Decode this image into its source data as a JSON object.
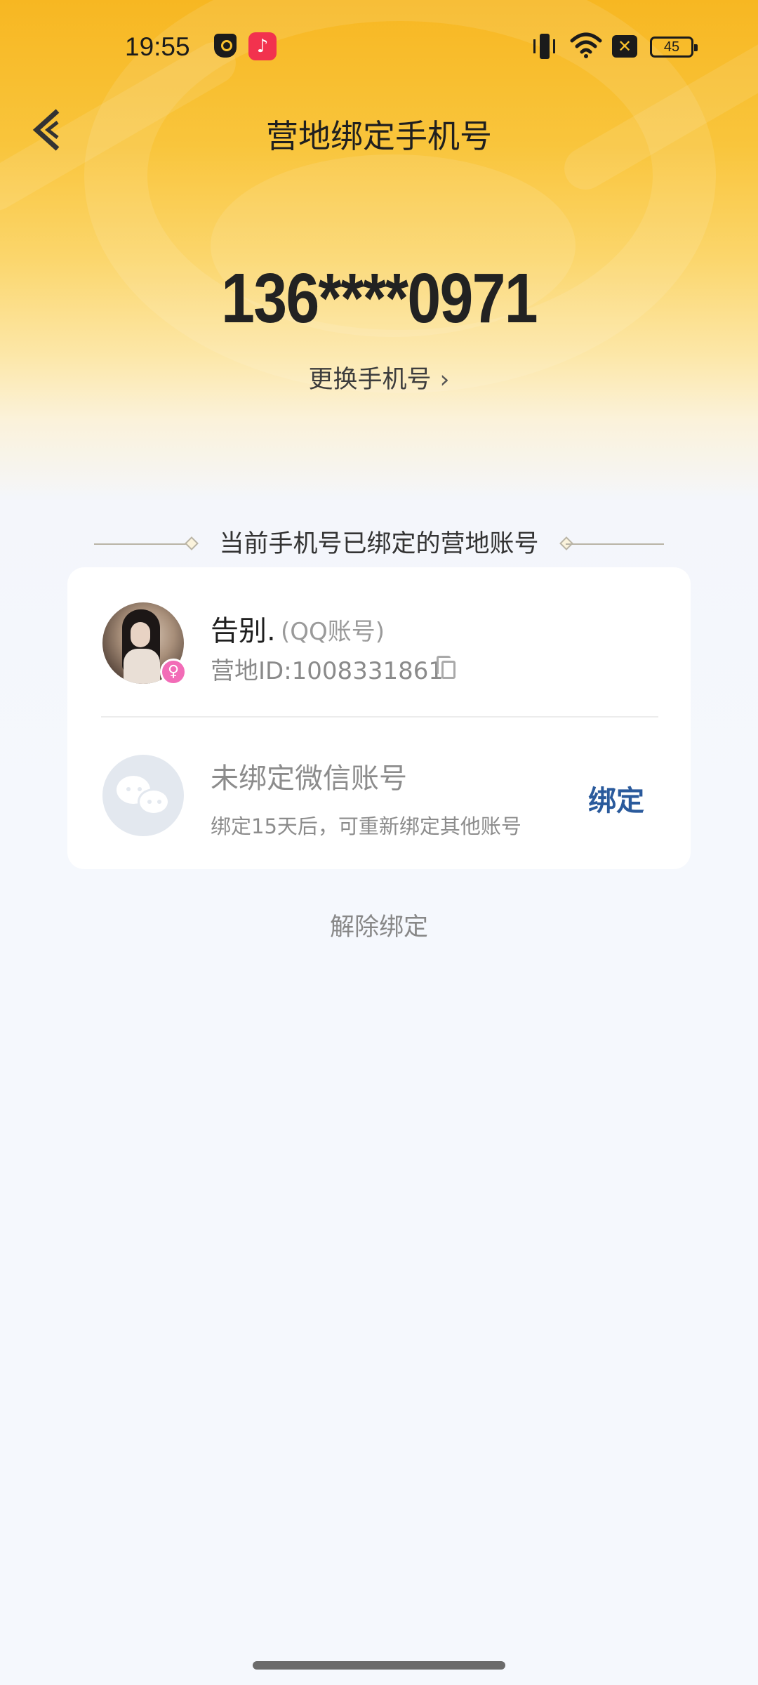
{
  "status_bar": {
    "time": "19:55",
    "battery": "45"
  },
  "header": {
    "title": "营地绑定手机号"
  },
  "phone": {
    "number": "136****0971",
    "change_label": "更换手机号",
    "change_chevron": "›"
  },
  "section": {
    "title": "当前手机号已绑定的营地账号"
  },
  "accounts": {
    "qq": {
      "name": "告别.",
      "type": "(QQ账号)",
      "camp_id": "营地ID:1008331861",
      "gender_symbol": "♀"
    },
    "wechat": {
      "title": "未绑定微信账号",
      "description": "绑定15天后，可重新绑定其他账号",
      "bind_label": "绑定"
    }
  },
  "actions": {
    "unbind_label": "解除绑定"
  },
  "icons": {
    "music_glyph": "♪",
    "x_glyph": "✕"
  },
  "colors": {
    "accent_blue": "#2a5a9c",
    "header_yellow": "#f7b722",
    "female_pink": "#f26cb7"
  }
}
